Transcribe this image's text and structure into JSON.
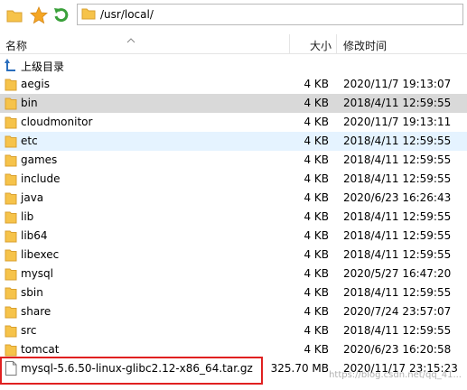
{
  "toolbar": {
    "icons": [
      "folder-icon",
      "star-icon",
      "refresh-icon"
    ],
    "path": "/usr/local/"
  },
  "columns": {
    "name": "名称",
    "size": "大小",
    "modified": "修改时间"
  },
  "parent": {
    "label": "上级目录",
    "icon": "up-arrow-icon"
  },
  "rows": [
    {
      "name": "aegis",
      "size": "4 KB",
      "date": "2020/11/7 19:13:07",
      "type": "folder"
    },
    {
      "name": "bin",
      "size": "4 KB",
      "date": "2018/4/11 12:59:55",
      "type": "folder",
      "state": "selected"
    },
    {
      "name": "cloudmonitor",
      "size": "4 KB",
      "date": "2020/11/7 19:13:11",
      "type": "folder"
    },
    {
      "name": "etc",
      "size": "4 KB",
      "date": "2018/4/11 12:59:55",
      "type": "folder",
      "state": "hover"
    },
    {
      "name": "games",
      "size": "4 KB",
      "date": "2018/4/11 12:59:55",
      "type": "folder"
    },
    {
      "name": "include",
      "size": "4 KB",
      "date": "2018/4/11 12:59:55",
      "type": "folder"
    },
    {
      "name": "java",
      "size": "4 KB",
      "date": "2020/6/23 16:26:43",
      "type": "folder"
    },
    {
      "name": "lib",
      "size": "4 KB",
      "date": "2018/4/11 12:59:55",
      "type": "folder"
    },
    {
      "name": "lib64",
      "size": "4 KB",
      "date": "2018/4/11 12:59:55",
      "type": "folder"
    },
    {
      "name": "libexec",
      "size": "4 KB",
      "date": "2018/4/11 12:59:55",
      "type": "folder"
    },
    {
      "name": "mysql",
      "size": "4 KB",
      "date": "2020/5/27 16:47:20",
      "type": "folder"
    },
    {
      "name": "sbin",
      "size": "4 KB",
      "date": "2018/4/11 12:59:55",
      "type": "folder"
    },
    {
      "name": "share",
      "size": "4 KB",
      "date": "2020/7/24 23:57:07",
      "type": "folder"
    },
    {
      "name": "src",
      "size": "4 KB",
      "date": "2018/4/11 12:59:55",
      "type": "folder"
    },
    {
      "name": "tomcat",
      "size": "4 KB",
      "date": "2020/6/23 16:20:58",
      "type": "folder"
    },
    {
      "name": "mysql-5.6.50-linux-glibc2.12-x86_64.tar.gz",
      "size": "325.70 MB",
      "date": "2020/11/17 23:15:23",
      "type": "file"
    }
  ],
  "colors": {
    "folder": "#f6c34a",
    "selected_row": "#d9d9d9",
    "hover_row": "#e5f3ff",
    "highlight_box": "#e02020"
  },
  "watermark": "https://blog.csdn.net/qq_41..."
}
